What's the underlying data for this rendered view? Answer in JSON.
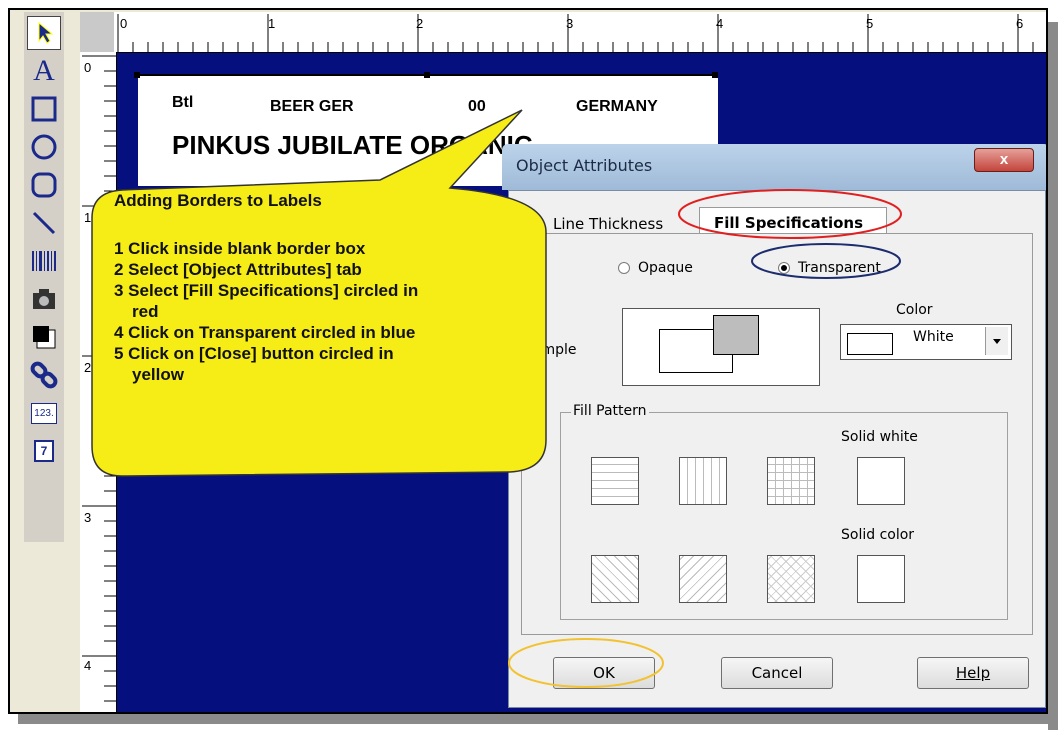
{
  "toolbox": {
    "tools": [
      {
        "name": "pointer-tool",
        "icon": "arrow-pointer-icon"
      },
      {
        "name": "text-tool",
        "icon": "letter-a-icon",
        "glyph": "A"
      },
      {
        "name": "rectangle-tool",
        "icon": "rectangle-icon"
      },
      {
        "name": "ellipse-tool",
        "icon": "ellipse-icon"
      },
      {
        "name": "rounded-rectangle-tool",
        "icon": "rounded-rectangle-icon"
      },
      {
        "name": "line-tool",
        "icon": "line-icon"
      },
      {
        "name": "barcode-tool",
        "icon": "barcode-icon"
      },
      {
        "name": "image-tool",
        "icon": "camera-icon"
      },
      {
        "name": "fill-tool",
        "icon": "fill-square-icon"
      },
      {
        "name": "link-tool",
        "icon": "chain-link-icon"
      },
      {
        "name": "counter-tool",
        "icon": "counter-icon",
        "glyph": "123."
      },
      {
        "name": "date-tool",
        "icon": "calendar-icon",
        "glyph": "7"
      }
    ]
  },
  "ruler": {
    "horizontal_labels": [
      "0",
      "1",
      "2",
      "3",
      "4",
      "5",
      "6"
    ],
    "vertical_labels": [
      "0",
      "1",
      "2",
      "3",
      "4"
    ]
  },
  "label": {
    "field_type": "Btl",
    "field_category": "BEER GER",
    "field_code": "00",
    "field_country": "GERMANY",
    "product_name": "PINKUS JUBILATE ORGANIC"
  },
  "callout": {
    "title": "Adding Borders to Labels",
    "steps": [
      "1 Click inside blank border box",
      "2 Select [Object Attributes] tab",
      "3 Select [Fill Specifications] circled in",
      "red",
      "4 Click on Transparent circled in blue",
      "5 Click on [Close] button circled in",
      "yellow"
    ]
  },
  "dialog": {
    "title": "Object Attributes",
    "close_glyph": "x",
    "tabs": {
      "line_thickness": "Line Thickness",
      "fill_specifications": "Fill Specifications"
    },
    "opacity": {
      "opaque": "Opaque",
      "transparent": "Transparent",
      "selected": "Transparent"
    },
    "sample_label": "Sample",
    "color_label": "Color",
    "color_value": "White",
    "fill_pattern_label": "Fill Pattern",
    "solid_white_label": "Solid white",
    "solid_color_label": "Solid color",
    "buttons": {
      "ok": "OK",
      "cancel": "Cancel",
      "help": "Help"
    }
  },
  "colors": {
    "canvas": "#05107e",
    "callout_fill": "#f6ec16",
    "red_circle": "#e02020",
    "blue_circle": "#1c2c6e",
    "yellow_circle": "#f2c230"
  }
}
